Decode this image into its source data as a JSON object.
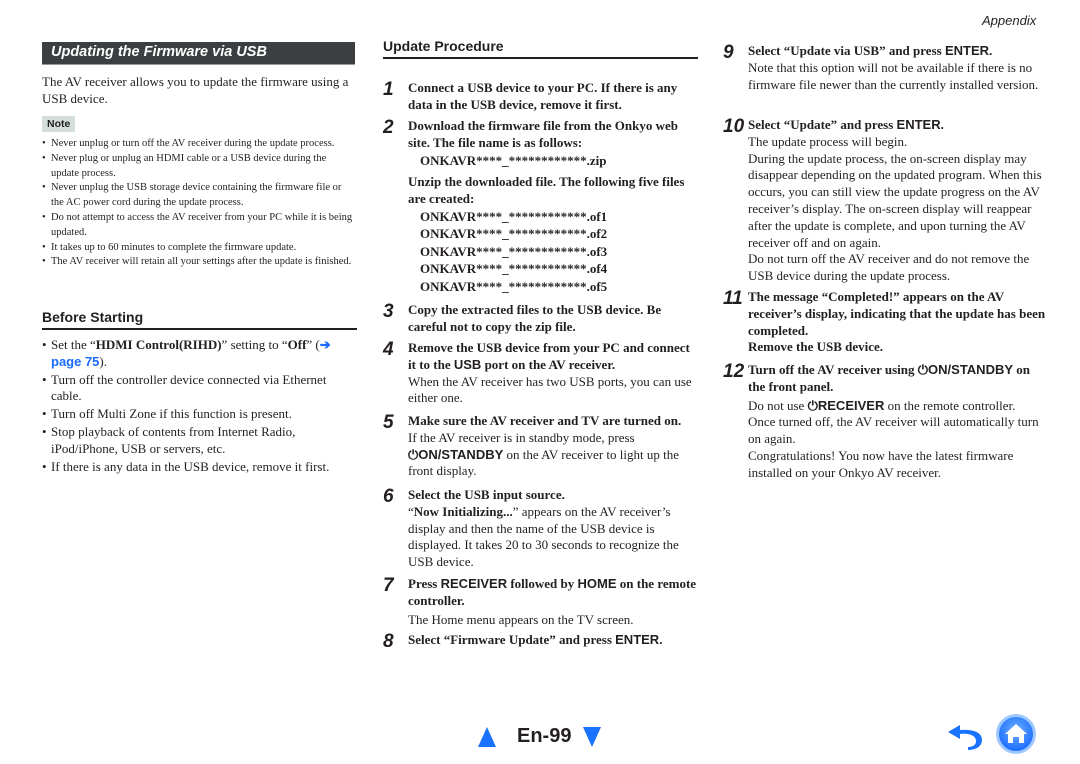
{
  "header": {
    "section": "Appendix"
  },
  "left": {
    "banner_title": "Updating the Firmware via USB",
    "intro": "The AV receiver allows you to update the firmware using a USB device.",
    "note_label": "Note",
    "notes": [
      "Never unplug or turn off the AV receiver during the update process.",
      "Never plug or unplug an HDMI cable or a USB device during the update process.",
      "Never unplug the USB storage device containing the firmware file or the AC power cord during the update process.",
      "Do not attempt to access the AV receiver from your PC while it is being updated.",
      "It takes up to 60 minutes to complete the firmware update.",
      "The AV receiver will retain all your settings after the update is finished."
    ],
    "before_title": "Before Starting",
    "before_items": {
      "item1_pre": "Set the “",
      "item1_bold1": "HDMI Control(RIHD)",
      "item1_mid": "” setting to “",
      "item1_bold2": "Off",
      "item1_post1": "” (",
      "item1_link": "➔ page 75",
      "item1_post2": ").",
      "item2": "Turn off the controller device connected via Ethernet cable.",
      "item3": "Turn off Multi Zone if this function is present.",
      "item4": "Stop playback of contents from Internet Radio, iPod/iPhone, USB or servers, etc.",
      "item5": "If there is any data in the USB device, remove it first."
    }
  },
  "procedure": {
    "title": "Update Procedure",
    "steps": {
      "s1": {
        "num": "1",
        "title": "Connect a USB device to your PC. If there is any data in the USB device, remove it first."
      },
      "s2": {
        "num": "2",
        "title": "Download the firmware file from the Onkyo web site. The file name is as follows:",
        "zip": "ONKAVR****_************.zip",
        "unzip": "Unzip the downloaded file. The following five files are created:",
        "files": [
          "ONKAVR****_************.of1",
          "ONKAVR****_************.of2",
          "ONKAVR****_************.of3",
          "ONKAVR****_************.of4",
          "ONKAVR****_************.of5"
        ]
      },
      "s3": {
        "num": "3",
        "title": "Copy the extracted files to the USB device. Be careful not to copy the zip file."
      },
      "s4": {
        "num": "4",
        "title_pre": "Remove the USB device from your PC and connect it to the ",
        "title_key": "USB",
        "title_post": " port on the AV receiver.",
        "body": "When the AV receiver has two USB ports, you can use either one."
      },
      "s5": {
        "num": "5",
        "title": "Make sure the AV receiver and TV are turned on.",
        "body_pre": "If the AV receiver is in standby mode, press ",
        "body_key": "⏻ON/STANDBY",
        "body_post": " on the AV receiver to light up the front display."
      },
      "s6": {
        "num": "6",
        "title": "Select the USB input source.",
        "body_q1": "“",
        "body_bold": "Now Initializing...",
        "body_post": "” appears on the AV receiver’s display and then the name of the USB device is displayed. It takes 20 to 30 seconds to recognize the USB device."
      },
      "s7": {
        "num": "7",
        "title_pre": "Press ",
        "key1": "RECEIVER",
        "title_mid": " followed by ",
        "key2": "HOME",
        "title_post": " on the remote controller.",
        "body": "The Home menu appears on the TV screen."
      },
      "s8": {
        "num": "8",
        "title_pre": "Select “Firmware Update” and press ",
        "key": "ENTER",
        "title_post": "."
      },
      "s9": {
        "num": "9",
        "title_pre": "Select “Update via USB” and press ",
        "key": "ENTER",
        "title_post": ".",
        "body": "Note that this option will not be available if there is no firmware file newer than the currently installed version."
      },
      "s10": {
        "num": "10",
        "title_pre": "Select “Update” and press ",
        "key": "ENTER",
        "title_post": ".",
        "body1": "The update process will begin.",
        "body2": "During the update process, the on-screen display may disappear depending on the updated program. When this occurs, you can still view the update progress on the AV receiver’s display. The on-screen display will reappear after the update is complete, and upon turning the AV receiver off and on again.",
        "body3": "Do not turn off the AV receiver and do not remove the USB device during the update process."
      },
      "s11": {
        "num": "11",
        "title": "The message “Completed!” appears on the AV receiver’s display, indicating that the update has been completed.",
        "title2": "Remove the USB device."
      },
      "s12": {
        "num": "12",
        "title_pre": "Turn off the AV receiver using ",
        "key": "⏻ON/STANDBY",
        "title_post": " on the front panel.",
        "body1_pre": "Do not use ",
        "body1_key": "⏻RECEIVER",
        "body1_post": " on the remote controller.",
        "body2": "Once turned off, the AV receiver will automatically turn on again.",
        "body3": "Congratulations! You now have the latest firmware installed on your Onkyo AV receiver."
      }
    }
  },
  "footer": {
    "page_number": "En-99",
    "prev_icon": "triangle-up",
    "next_icon": "triangle-down",
    "back_icon": "back-arrow",
    "home_icon": "home",
    "accent_color": "#1a73ff"
  }
}
